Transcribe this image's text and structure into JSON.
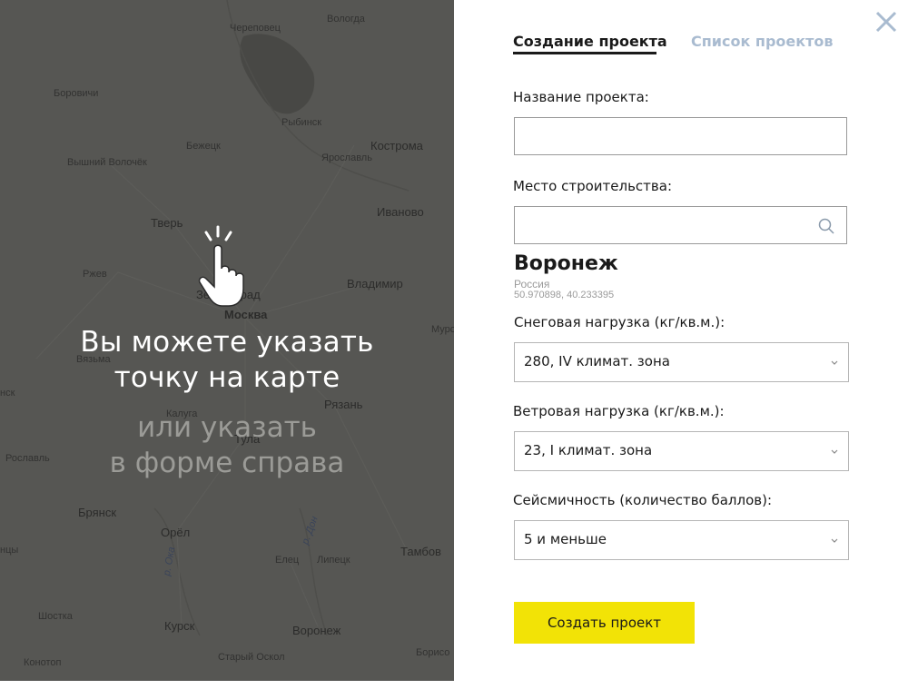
{
  "map": {
    "cities": [
      {
        "name": "Череповец",
        "big": false
      },
      {
        "name": "Вологда",
        "big": false
      },
      {
        "name": "Боровичи",
        "big": false
      },
      {
        "name": "Рыбинск",
        "big": false
      },
      {
        "name": "Бежецк",
        "big": false
      },
      {
        "name": "Кострома",
        "big": true
      },
      {
        "name": "Вышний Волочёк",
        "big": false
      },
      {
        "name": "Ярославль",
        "big": false
      },
      {
        "name": "Тверь",
        "big": true
      },
      {
        "name": "Иваново",
        "big": true
      },
      {
        "name": "Ржев",
        "big": false
      },
      {
        "name": "Зеленоград",
        "big": true
      },
      {
        "name": "Владимир",
        "big": true
      },
      {
        "name": "Москва",
        "big": true
      },
      {
        "name": "Муром",
        "big": false
      },
      {
        "name": "Вязьма",
        "big": false
      },
      {
        "name": "нск",
        "big": false
      },
      {
        "name": "Рязань",
        "big": true
      },
      {
        "name": "Калуга",
        "big": false
      },
      {
        "name": "Тула",
        "big": true
      },
      {
        "name": "Рославль",
        "big": false
      },
      {
        "name": "Брянск",
        "big": true
      },
      {
        "name": "Орёл",
        "big": true
      },
      {
        "name": "Тамбов",
        "big": true
      },
      {
        "name": "Елец",
        "big": false
      },
      {
        "name": "Липецк",
        "big": false
      },
      {
        "name": "нцы",
        "big": false
      },
      {
        "name": "Шостка",
        "big": false
      },
      {
        "name": "Курск",
        "big": true
      },
      {
        "name": "Воронеж",
        "big": true
      },
      {
        "name": "Старый Оскол",
        "big": false
      },
      {
        "name": "Конотоп",
        "big": false
      },
      {
        "name": "Борисо",
        "big": false
      },
      {
        "name": "р. Ока",
        "big": false
      },
      {
        "name": "р. Дон",
        "big": false
      }
    ],
    "hint_line1": "Вы можете указать",
    "hint_line2": "точку на карте",
    "alt_line1": "или указать",
    "alt_line2": "в форме справа"
  },
  "panel": {
    "tabs": [
      {
        "label": "Создание проекта",
        "active": true
      },
      {
        "label": "Список проектов",
        "active": false
      }
    ],
    "project_name_label": "Название проекта:",
    "project_name_value": "",
    "place_label": "Место строительства:",
    "place_value": "",
    "selected_city": "Воронеж",
    "selected_country": "Россия",
    "selected_coords": "50.970898, 40.233395",
    "snow_label": "Снеговая нагрузка (кг/кв.м.):",
    "snow_value": "280, IV климат. зона",
    "wind_label": "Ветровая нагрузка (кг/кв.м.):",
    "wind_value": "23, I климат. зона",
    "seismic_label": "Сейсмичность (количество баллов):",
    "seismic_value": "5 и меньше",
    "create_button": "Создать проект"
  },
  "colors": {
    "accent_button": "#f2e306",
    "inactive_tab": "#a9bbd0",
    "close_icon": "#a9bbd0"
  }
}
